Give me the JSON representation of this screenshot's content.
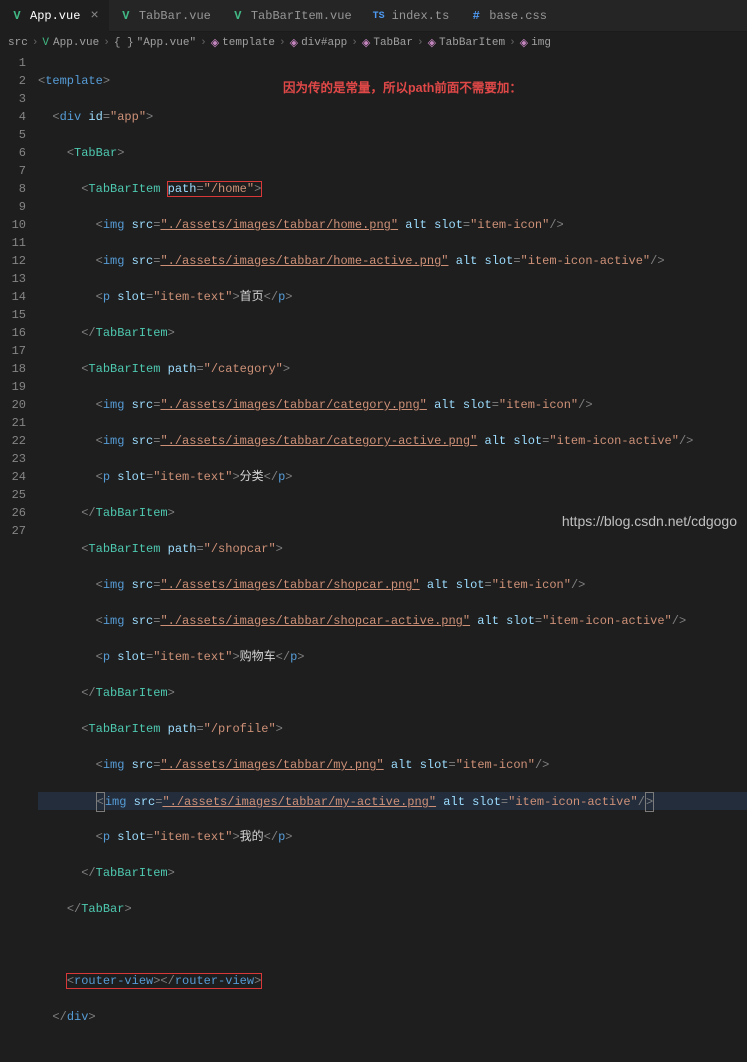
{
  "tabs": [
    {
      "label": "App.vue",
      "icon": "V",
      "active": true
    },
    {
      "label": "TabBar.vue",
      "icon": "V"
    },
    {
      "label": "TabBarItem.vue",
      "icon": "V"
    },
    {
      "label": "index.ts",
      "icon": "TS"
    },
    {
      "label": "base.css",
      "icon": "#"
    }
  ],
  "breadcrumb": [
    "src",
    "App.vue",
    "{ }",
    "\"App.vue\"",
    "template",
    "div#app",
    "TabBar",
    "TabBarItem",
    "img"
  ],
  "annotation": "因为传的是常量，所以path前面不需要加：",
  "watermark": "https://blog.csdn.net/cdgogo",
  "chart_data": {
    "type": "table",
    "note": "Vue template source (App.vue)",
    "items": [
      {
        "path": "/home",
        "icon": "./assets/images/tabbar/home.png",
        "iconActive": "./assets/images/tabbar/home-active.png",
        "text": "首页"
      },
      {
        "path": "/category",
        "icon": "./assets/images/tabbar/category.png",
        "iconActive": "./assets/images/tabbar/category-active.png",
        "text": "分类"
      },
      {
        "path": "/shopcar",
        "icon": "./assets/images/tabbar/shopcar.png",
        "iconActive": "./assets/images/tabbar/shopcar-active.png",
        "text": "购物车"
      },
      {
        "path": "/profile",
        "icon": "./assets/images/tabbar/my.png",
        "iconActive": "./assets/images/tabbar/my-active.png",
        "text": "我的"
      }
    ]
  },
  "lines": {
    "l1": "<template>",
    "l2": "  <div id=\"app\">",
    "l3": "    <TabBar>",
    "l4": "      <TabBarItem path=\"/home\">",
    "l5": "        <img src=\"./assets/images/tabbar/home.png\" alt slot=\"item-icon\"/>",
    "l6": "        <img src=\"./assets/images/tabbar/home-active.png\" alt slot=\"item-icon-active\"/>",
    "l7": "        <p slot=\"item-text\">首页</p>",
    "l8": "      </TabBarItem>",
    "l9": "      <TabBarItem path=\"/category\">",
    "l10": "        <img src=\"./assets/images/tabbar/category.png\" alt slot=\"item-icon\"/>",
    "l11": "        <img src=\"./assets/images/tabbar/category-active.png\" alt slot=\"item-icon-active\"/>",
    "l12": "        <p slot=\"item-text\">分类</p>",
    "l13": "      </TabBarItem>",
    "l14": "      <TabBarItem path=\"/shopcar\">",
    "l15": "        <img src=\"./assets/images/tabbar/shopcar.png\" alt slot=\"item-icon\"/>",
    "l16": "        <img src=\"./assets/images/tabbar/shopcar-active.png\" alt slot=\"item-icon-active\"/>",
    "l17": "        <p slot=\"item-text\">购物车</p>",
    "l18": "      </TabBarItem>",
    "l19": "      <TabBarItem path=\"/profile\">",
    "l20": "        <img src=\"./assets/images/tabbar/my.png\" alt slot=\"item-icon\"/>",
    "l21": "        <img src=\"./assets/images/tabbar/my-active.png\" alt slot=\"item-icon-active\"/>",
    "l22": "        <p slot=\"item-text\">我的</p>",
    "l23": "      </TabBarItem>",
    "l24": "    </TabBar>",
    "l25": "",
    "l26": "    <router-view></router-view>",
    "l27": "  </div>"
  }
}
